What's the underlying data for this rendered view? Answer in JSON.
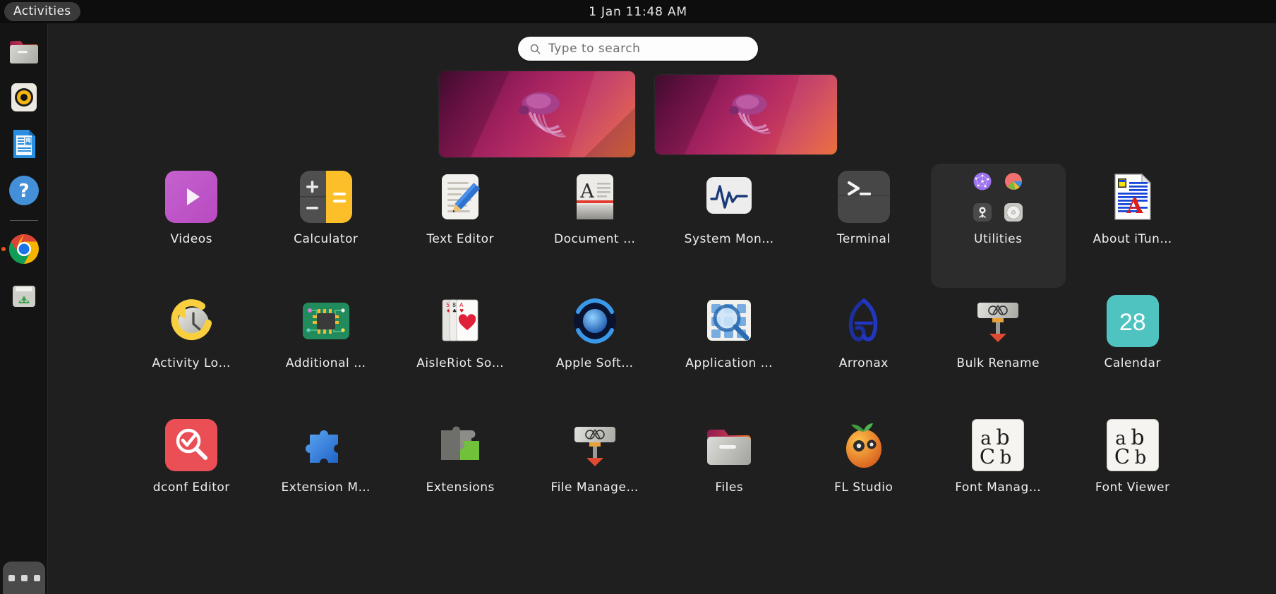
{
  "topbar": {
    "activities_label": "Activities",
    "clock": "1 Jan 11:48 AM"
  },
  "search": {
    "placeholder": "Type to search",
    "icon": "search-icon",
    "value": ""
  },
  "dock": {
    "items": [
      {
        "name": "files",
        "icon": "folder-icon",
        "running": false
      },
      {
        "name": "rhythmbox",
        "icon": "music-speaker-icon",
        "running": false
      },
      {
        "name": "libreoffice-writer",
        "icon": "document-icon",
        "running": false
      },
      {
        "name": "help",
        "icon": "question-mark-icon",
        "running": false
      },
      {
        "name": "google-chrome",
        "icon": "chrome-icon",
        "running": true
      },
      {
        "name": "trash",
        "icon": "trash-bin-icon",
        "running": false
      }
    ],
    "show_apps_label": "Show Applications",
    "show_apps_icon": "grid-dots-icon"
  },
  "workspaces": [
    {
      "name": "workspace-1",
      "active": true
    },
    {
      "name": "workspace-2",
      "active": false
    }
  ],
  "grid": {
    "apps": [
      {
        "label": "Videos",
        "icon": "videos-icon",
        "kind": "videos"
      },
      {
        "label": "Calculator",
        "icon": "calculator-icon",
        "kind": "calculator"
      },
      {
        "label": "Text Editor",
        "icon": "text-editor-icon",
        "kind": "texteditor"
      },
      {
        "label": "Document …",
        "icon": "document-viewer-icon",
        "kind": "docviewer"
      },
      {
        "label": "System Mon…",
        "icon": "system-monitor-icon",
        "kind": "sysmon"
      },
      {
        "label": "Terminal",
        "icon": "terminal-icon",
        "kind": "terminal"
      },
      {
        "label": "Utilities",
        "icon": "folder-utilities-icon",
        "kind": "utilities",
        "folder": true
      },
      {
        "label": "About iTun…",
        "icon": "rtf-document-icon",
        "kind": "aboutitunes"
      },
      {
        "label": "Activity Lo…",
        "icon": "activity-log-icon",
        "kind": "activitylog"
      },
      {
        "label": "Additional …",
        "icon": "additional-drivers-icon",
        "kind": "drivers"
      },
      {
        "label": "AisleRiot So…",
        "icon": "aisleriot-cards-icon",
        "kind": "aisleriot"
      },
      {
        "label": "Apple Soft…",
        "icon": "apple-software-update-icon",
        "kind": "applesoft"
      },
      {
        "label": "Application …",
        "icon": "application-finder-icon",
        "kind": "appfinder"
      },
      {
        "label": "Arronax",
        "icon": "arronax-icon",
        "kind": "arronax"
      },
      {
        "label": "Bulk Rename",
        "icon": "bulk-rename-icon",
        "kind": "bulkrename"
      },
      {
        "label": "Calendar",
        "icon": "calendar-icon",
        "kind": "calendar",
        "day": "28"
      },
      {
        "label": "dconf Editor",
        "icon": "dconf-editor-icon",
        "kind": "dconf"
      },
      {
        "label": "Extension M…",
        "icon": "extension-manager-icon",
        "kind": "extmanager"
      },
      {
        "label": "Extensions",
        "icon": "extensions-icon",
        "kind": "extensions"
      },
      {
        "label": "File Manage…",
        "icon": "file-manager-icon",
        "kind": "filemanager"
      },
      {
        "label": "Files",
        "icon": "files-folder-icon",
        "kind": "filesfolder"
      },
      {
        "label": "FL Studio",
        "icon": "fl-studio-icon",
        "kind": "flstudio"
      },
      {
        "label": "Font Manag…",
        "icon": "font-manager-icon",
        "kind": "fontmanager"
      },
      {
        "label": "Font Viewer",
        "icon": "font-viewer-icon",
        "kind": "fontviewer"
      }
    ]
  },
  "colors": {
    "background": "#1f1f1f",
    "topbar": "#0d0d0d",
    "dock": "#141414",
    "accent": "#e95420",
    "text": "#efefef",
    "search_bg": "#fdfdfd",
    "folder_bg": "#2c2c2c"
  }
}
